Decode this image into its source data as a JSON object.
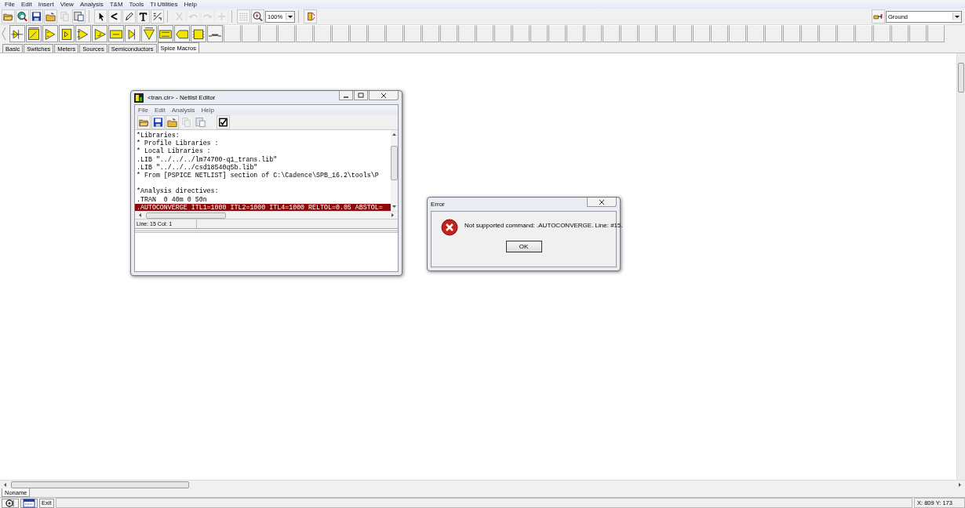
{
  "menu": [
    "File",
    "Edit",
    "Insert",
    "View",
    "Analysis",
    "T&M",
    "Tools",
    "TI Utilities",
    "Help"
  ],
  "toolbar": {
    "buttons": [
      {
        "kind": "open",
        "disabled": false
      },
      {
        "kind": "search",
        "disabled": false
      },
      {
        "kind": "save",
        "disabled": false
      },
      {
        "kind": "folder",
        "disabled": false
      },
      {
        "kind": "copy",
        "disabled": true
      },
      {
        "kind": "paste",
        "disabled": false
      },
      {
        "kind": "sep"
      },
      {
        "kind": "pointer",
        "disabled": false
      },
      {
        "kind": "wire",
        "disabled": false
      },
      {
        "kind": "pen",
        "disabled": false
      },
      {
        "kind": "text",
        "disabled": false
      },
      {
        "kind": "fraction",
        "disabled": false
      },
      {
        "kind": "sep"
      },
      {
        "kind": "cut",
        "disabled": true
      },
      {
        "kind": "undo",
        "disabled": true
      },
      {
        "kind": "redo",
        "disabled": true
      },
      {
        "kind": "plus",
        "disabled": true
      },
      {
        "kind": "sep"
      },
      {
        "kind": "grid",
        "disabled": false
      },
      {
        "kind": "zoom",
        "disabled": false
      }
    ],
    "zoom": "100%",
    "ground": "Ground"
  },
  "palette_tabs": [
    {
      "label": "Basic",
      "selected": false
    },
    {
      "label": "Switches",
      "selected": false
    },
    {
      "label": "Meters",
      "selected": false
    },
    {
      "label": "Sources",
      "selected": false
    },
    {
      "label": "Semiconductors",
      "selected": false
    },
    {
      "label": "Spice Macros",
      "selected": true
    }
  ],
  "netlist_editor": {
    "title": "<tran.cir> - Netlist Editor",
    "menu": [
      "File",
      "Edit",
      "Analysis",
      "Help"
    ],
    "blocks": [
      {
        "lines": [
          {
            "text": "*Libraries:",
            "selected": false
          },
          {
            "text": "* Profile Libraries :",
            "selected": false
          },
          {
            "text": "* Local Libraries :",
            "selected": false
          },
          {
            "text": ".LIB \"../../../lm74700-q1_trans.lib\"",
            "selected": false
          },
          {
            "text": ".LIB \"../../../csd18540q5b.lib\"",
            "selected": false
          },
          {
            "text": "* From [PSPICE NETLIST] section of C:\\Cadence\\SPB_16.2\\tools\\P",
            "selected": false
          }
        ]
      },
      {
        "lines": [
          {
            "text": "*Analysis directives:",
            "selected": false
          },
          {
            "text": ".TRAN  0 40m 0 50n",
            "selected": false
          },
          {
            "text": ".AUTOCONVERGE ITL1=1000 ITL2=1000 ITL4=1000 RELTOL=0.05 ABSTOL=",
            "selected": true
          }
        ]
      }
    ],
    "status": "Line: 15 Col: 1"
  },
  "error_dialog": {
    "title": "Error",
    "message": "Not supported command: .AUTOCONVERGE. Line: #15.",
    "button": "OK"
  },
  "sheet_tabs": [
    {
      "label": "Noname",
      "selected": true
    }
  ],
  "status_bar": {
    "exit": "Exit",
    "coordinates": "X: 809 Y: 173"
  }
}
